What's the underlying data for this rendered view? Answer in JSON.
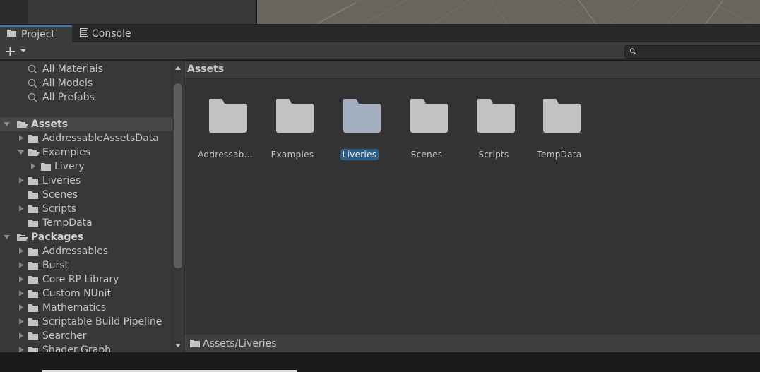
{
  "tabs": [
    {
      "label": "Project",
      "icon": "folder-icon",
      "active": true
    },
    {
      "label": "Console",
      "icon": "console-icon",
      "active": false
    }
  ],
  "toolbar": {
    "add_icon": "plus-icon",
    "add_dropdown_icon": "caret-down-icon",
    "search_placeholder": "",
    "search_value": ""
  },
  "favorites": [
    {
      "label": "All Materials",
      "icon": "search-icon"
    },
    {
      "label": "All Models",
      "icon": "search-icon"
    },
    {
      "label": "All Prefabs",
      "icon": "search-icon"
    }
  ],
  "tree": {
    "assets": {
      "label": "Assets",
      "expanded": true,
      "children": [
        {
          "label": "AddressableAssetsData",
          "has_children": true,
          "expanded": false
        },
        {
          "label": "Examples",
          "has_children": true,
          "expanded": true,
          "children": [
            {
              "label": "Livery",
              "has_children": true,
              "expanded": false
            }
          ]
        },
        {
          "label": "Liveries",
          "has_children": true,
          "expanded": false
        },
        {
          "label": "Scenes",
          "has_children": false
        },
        {
          "label": "Scripts",
          "has_children": true,
          "expanded": false
        },
        {
          "label": "TempData",
          "has_children": false
        }
      ]
    },
    "packages": {
      "label": "Packages",
      "expanded": true,
      "children": [
        {
          "label": "Addressables"
        },
        {
          "label": "Burst"
        },
        {
          "label": "Core RP Library"
        },
        {
          "label": "Custom NUnit"
        },
        {
          "label": "Mathematics"
        },
        {
          "label": "Scriptable Build Pipeline"
        },
        {
          "label": "Searcher"
        },
        {
          "label": "Shader Graph"
        }
      ]
    }
  },
  "content": {
    "breadcrumb": "Assets",
    "items": [
      {
        "label": "Addressab...",
        "selected": false
      },
      {
        "label": "Examples",
        "selected": false
      },
      {
        "label": "Liveries",
        "selected": true
      },
      {
        "label": "Scenes",
        "selected": false
      },
      {
        "label": "Scripts",
        "selected": false
      },
      {
        "label": "TempData",
        "selected": false
      }
    ],
    "status_path": "Assets/Liveries"
  },
  "colors": {
    "accent": "#3a79bb",
    "selection": "#2c5d87",
    "folder": "#c2c2c2",
    "folder_selected": "#a4afc1"
  }
}
